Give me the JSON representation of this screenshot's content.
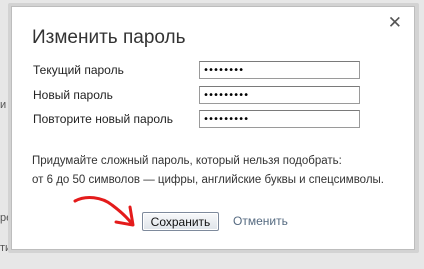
{
  "background": {
    "fragments": [
      "и",
      "ре",
      "ти"
    ]
  },
  "dialog": {
    "title": "Изменить пароль",
    "close_glyph": "✕",
    "fields": [
      {
        "label": "Текущий пароль",
        "value": "••••••••"
      },
      {
        "label": "Новый пароль",
        "value": "•••••••••"
      },
      {
        "label": "Повторите новый пароль",
        "value": "•••••••••"
      }
    ],
    "hint_line1": "Придумайте сложный пароль, который нельзя подобрать:",
    "hint_line2": "от 6 до 50 символов — цифры, английские буквы и спецсимволы.",
    "save_label": "Сохранить",
    "cancel_label": "Отменить"
  },
  "colors": {
    "annotation_arrow": "#e41b1b",
    "cancel_link": "#556a80"
  },
  "icons": {
    "close": "close-icon",
    "annotation": "red-arrow-annotation"
  }
}
